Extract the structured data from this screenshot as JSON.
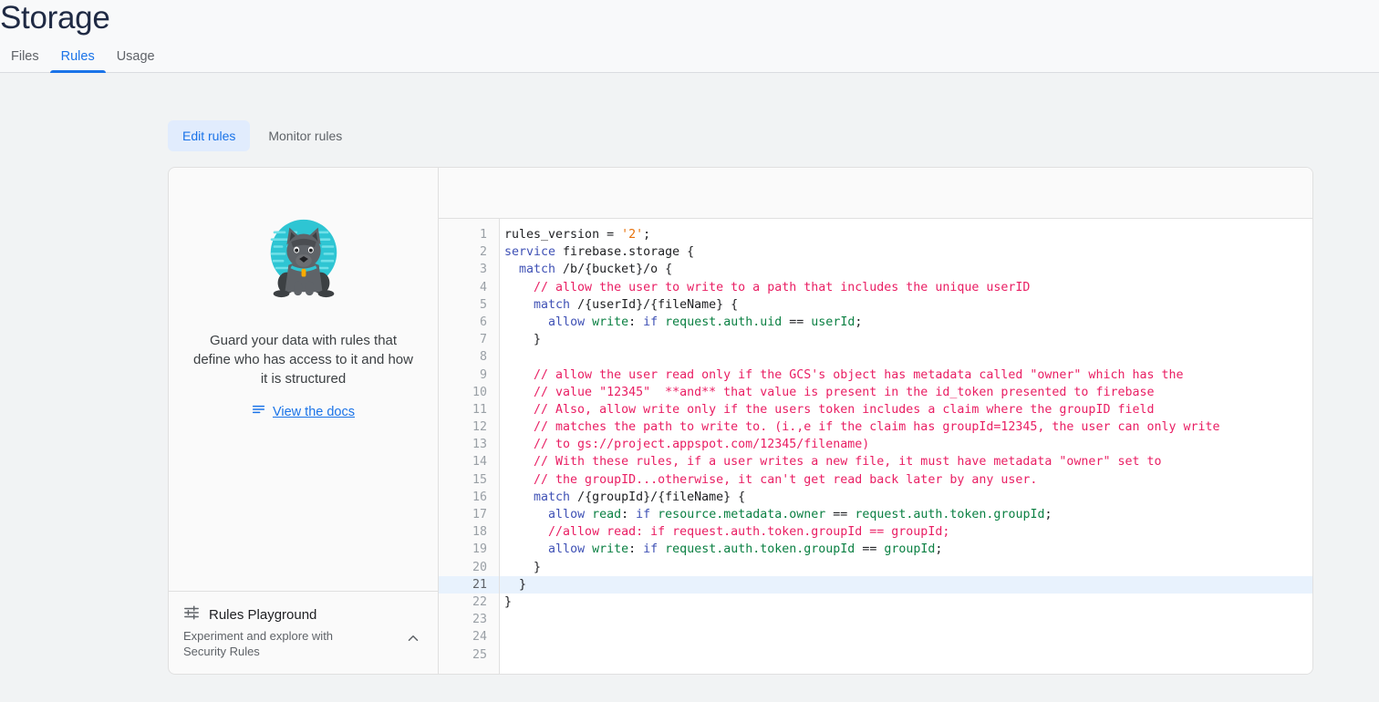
{
  "header": {
    "title": "Storage",
    "tabs": [
      {
        "label": "Files",
        "active": false
      },
      {
        "label": "Rules",
        "active": true
      },
      {
        "label": "Usage",
        "active": false
      }
    ]
  },
  "mode_toggle": {
    "buttons": [
      {
        "label": "Edit rules",
        "selected": true
      },
      {
        "label": "Monitor rules",
        "selected": false
      }
    ]
  },
  "left_panel": {
    "illustration": "guard-dog-illustration",
    "illustration_colors": {
      "circle": "#2ec5d3",
      "dash": "#6fe0e8",
      "dog_body": "#5f6368",
      "dog_dark": "#3c4043",
      "collar": "#2ec5d3",
      "tag": "#f9ab00"
    },
    "promo_text": "Guard your data with rules that define who has access to it and how it is structured",
    "docs_link": {
      "icon": "description-icon",
      "label": "View the docs"
    },
    "playground": {
      "icon": "tune-icon",
      "title": "Rules Playground",
      "subtitle": "Experiment and explore with Security Rules",
      "chevron": "chevron-up-icon"
    }
  },
  "editor": {
    "active_line": 21,
    "total_lines": 25,
    "line_numbers": [
      1,
      2,
      3,
      4,
      5,
      6,
      7,
      8,
      9,
      10,
      11,
      12,
      13,
      14,
      15,
      16,
      17,
      18,
      19,
      20,
      21,
      22,
      23,
      24,
      25
    ],
    "lines": [
      [
        {
          "t": "rules_version = ",
          "c": "t-plain"
        },
        {
          "t": "'2'",
          "c": "t-str"
        },
        {
          "t": ";",
          "c": "t-plain"
        }
      ],
      [
        {
          "t": "service",
          "c": "t-kw"
        },
        {
          "t": " firebase.storage {",
          "c": "t-plain"
        }
      ],
      [
        {
          "t": "  ",
          "c": "t-plain"
        },
        {
          "t": "match",
          "c": "t-kw"
        },
        {
          "t": " /b/{bucket}/o {",
          "c": "t-plain"
        }
      ],
      [
        {
          "t": "    // allow the user to write to a path that includes the unique userID",
          "c": "t-com"
        }
      ],
      [
        {
          "t": "    ",
          "c": "t-plain"
        },
        {
          "t": "match",
          "c": "t-kw"
        },
        {
          "t": " /{userId}/{fileName} {",
          "c": "t-plain"
        }
      ],
      [
        {
          "t": "      ",
          "c": "t-plain"
        },
        {
          "t": "allow",
          "c": "t-kw"
        },
        {
          "t": " ",
          "c": "t-plain"
        },
        {
          "t": "write",
          "c": "t-fn"
        },
        {
          "t": ": ",
          "c": "t-plain"
        },
        {
          "t": "if",
          "c": "t-kw"
        },
        {
          "t": " ",
          "c": "t-plain"
        },
        {
          "t": "request.auth.uid",
          "c": "t-fn"
        },
        {
          "t": " == ",
          "c": "t-plain"
        },
        {
          "t": "userId",
          "c": "t-fn"
        },
        {
          "t": ";",
          "c": "t-plain"
        }
      ],
      [
        {
          "t": "    }",
          "c": "t-plain"
        }
      ],
      [
        {
          "t": "",
          "c": "t-plain"
        }
      ],
      [
        {
          "t": "    // allow the user read only if the GCS's object has metadata called \"owner\" which has the",
          "c": "t-com"
        }
      ],
      [
        {
          "t": "    // value \"12345\"  **and** that value is present in the id_token presented to firebase",
          "c": "t-com"
        }
      ],
      [
        {
          "t": "    // Also, allow write only if the users token includes a claim where the groupID field",
          "c": "t-com"
        }
      ],
      [
        {
          "t": "    // matches the path to write to. (i.,e if the claim has groupId=12345, the user can only write",
          "c": "t-com"
        }
      ],
      [
        {
          "t": "    // to gs://project.appspot.com/12345/filename)",
          "c": "t-com"
        }
      ],
      [
        {
          "t": "    // With these rules, if a user writes a new file, it must have metadata \"owner\" set to",
          "c": "t-com"
        }
      ],
      [
        {
          "t": "    // the groupID...otherwise, it can't get read back later by any user.",
          "c": "t-com"
        }
      ],
      [
        {
          "t": "    ",
          "c": "t-plain"
        },
        {
          "t": "match",
          "c": "t-kw"
        },
        {
          "t": " /{groupId}/{fileName} {",
          "c": "t-plain"
        }
      ],
      [
        {
          "t": "      ",
          "c": "t-plain"
        },
        {
          "t": "allow",
          "c": "t-kw"
        },
        {
          "t": " ",
          "c": "t-plain"
        },
        {
          "t": "read",
          "c": "t-fn"
        },
        {
          "t": ": ",
          "c": "t-plain"
        },
        {
          "t": "if",
          "c": "t-kw"
        },
        {
          "t": " ",
          "c": "t-plain"
        },
        {
          "t": "resource.metadata.owner",
          "c": "t-fn"
        },
        {
          "t": " == ",
          "c": "t-plain"
        },
        {
          "t": "request.auth.token.groupId",
          "c": "t-fn"
        },
        {
          "t": ";",
          "c": "t-plain"
        }
      ],
      [
        {
          "t": "      //allow read: if request.auth.token.groupId == groupId;",
          "c": "t-com"
        }
      ],
      [
        {
          "t": "      ",
          "c": "t-plain"
        },
        {
          "t": "allow",
          "c": "t-kw"
        },
        {
          "t": " ",
          "c": "t-plain"
        },
        {
          "t": "write",
          "c": "t-fn"
        },
        {
          "t": ": ",
          "c": "t-plain"
        },
        {
          "t": "if",
          "c": "t-kw"
        },
        {
          "t": " ",
          "c": "t-plain"
        },
        {
          "t": "request.auth.token.groupId",
          "c": "t-fn"
        },
        {
          "t": " == ",
          "c": "t-plain"
        },
        {
          "t": "groupId",
          "c": "t-fn"
        },
        {
          "t": ";",
          "c": "t-plain"
        }
      ],
      [
        {
          "t": "    }",
          "c": "t-plain"
        }
      ],
      [
        {
          "t": "  }",
          "c": "t-plain"
        }
      ],
      [
        {
          "t": "}",
          "c": "t-plain"
        }
      ],
      [
        {
          "t": "",
          "c": "t-plain"
        }
      ],
      [
        {
          "t": "",
          "c": "t-plain"
        }
      ],
      [
        {
          "t": "",
          "c": "t-plain"
        }
      ]
    ]
  },
  "colors": {
    "accent": "#1a73e8",
    "accent_bg": "#e1ecfd",
    "page_bg": "#f1f3f4",
    "header_bg": "#f8f9fa",
    "panel_border": "#e0e0e0",
    "comment": "#e91e63",
    "keyword": "#3f51b5",
    "function": "#0b8043",
    "string": "#e8710a",
    "active_line": "#e8f2fd"
  }
}
